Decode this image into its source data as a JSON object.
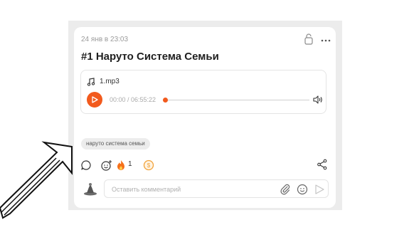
{
  "post": {
    "date": "24 янв в 23:03",
    "title": "#1 Наруто Система Семьи"
  },
  "audio": {
    "filename": "1.mp3",
    "time": "00:00 / 06:55:22",
    "progress": 0
  },
  "tags": [
    "наруто система семьи"
  ],
  "actions": {
    "reaction_count": "1"
  },
  "comment": {
    "placeholder": "Оставить комментарий"
  },
  "colors": {
    "accent": "#f25a1d",
    "coin": "#f2a23a"
  },
  "icons": [
    "lock-icon",
    "more-icon",
    "music-note-icon",
    "play-icon",
    "volume-icon",
    "comment-icon",
    "add-reaction-icon",
    "fire-icon",
    "donate-coin-icon",
    "share-icon",
    "attach-icon",
    "emoji-icon",
    "send-icon",
    "arrow-annotation"
  ]
}
